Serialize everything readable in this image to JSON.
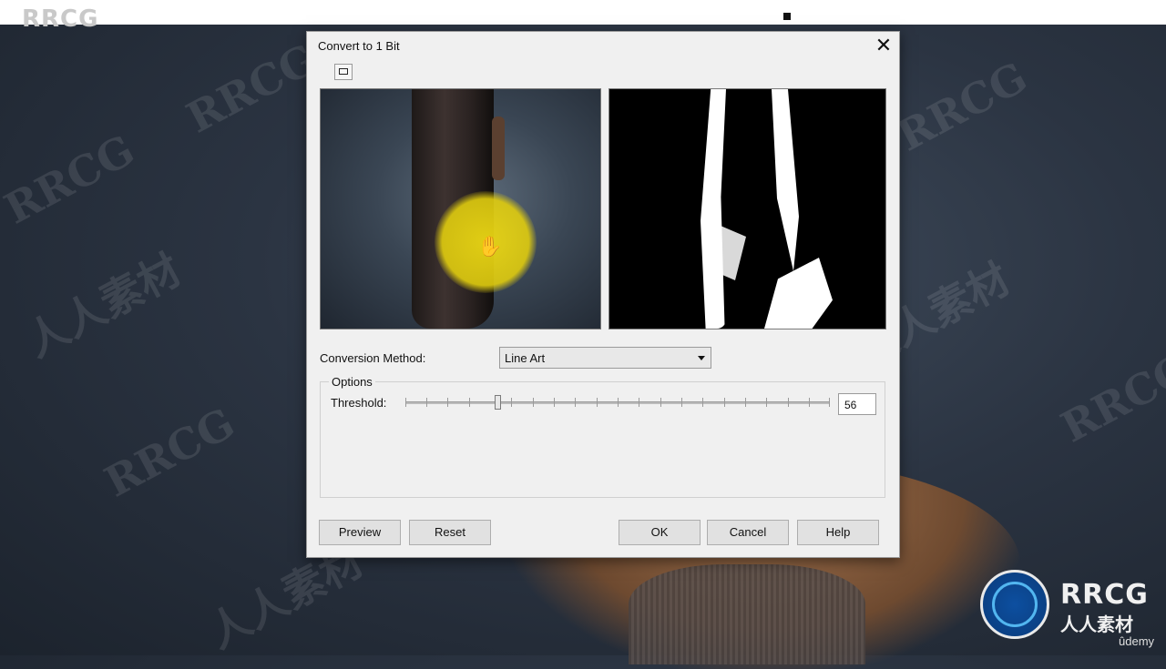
{
  "watermark": {
    "brand": "RRCG",
    "cn": "人人素材"
  },
  "dialog": {
    "title": "Convert to 1 Bit",
    "close_glyph": "✕",
    "conversion_method_label": "Conversion Method:",
    "conversion_method_value": "Line Art",
    "options_title": "Options",
    "threshold_label": "Threshold:",
    "threshold_value": "56",
    "buttons": {
      "preview": "Preview",
      "reset": "Reset",
      "ok": "OK",
      "cancel": "Cancel",
      "help": "Help"
    }
  },
  "icons": {
    "hand_cursor": "✋"
  },
  "logo": {
    "text": "RRCG",
    "sub": "人人素材",
    "udemy": "ûdemy"
  }
}
